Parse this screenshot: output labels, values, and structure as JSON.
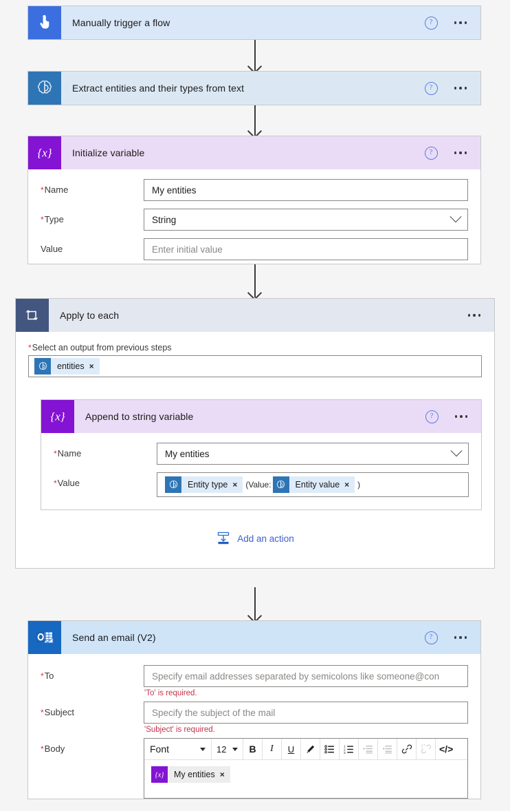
{
  "flow": {
    "steps": [
      {
        "id": "trigger",
        "title": "Manually trigger a flow",
        "icon": "hand-pointer-icon",
        "help_label": "?",
        "menu_label": "more-commands"
      },
      {
        "id": "extract-entities",
        "title": "Extract entities and their types from text",
        "icon": "ai-builder-brain-icon"
      },
      {
        "id": "initialize-variable",
        "title": "Initialize variable",
        "icon": "variable-braces-icon",
        "fields": {
          "name": {
            "label": "Name",
            "required": true,
            "value": "My entities"
          },
          "type": {
            "label": "Type",
            "required": true,
            "value": "String"
          },
          "value": {
            "label": "Value",
            "required": false,
            "value": "",
            "placeholder": "Enter initial value"
          }
        }
      },
      {
        "id": "apply-to-each",
        "title": "Apply to each",
        "icon": "loop-icon",
        "select_output": {
          "label": "Select an output from previous steps",
          "required": true,
          "token": {
            "text": "entities",
            "icon": "ai-builder-brain-icon",
            "remove": "×"
          }
        },
        "add_action": {
          "label": "Add an action",
          "icon": "add-action-icon"
        }
      },
      {
        "id": "append-to-string-variable",
        "title": "Append to string variable",
        "icon": "variable-braces-icon",
        "fields": {
          "name": {
            "label": "Name",
            "required": true,
            "value": "My entities"
          },
          "value": {
            "label": "Value",
            "required": true,
            "tokens": [
              {
                "text": "Entity type",
                "icon": "ai-builder-brain-icon",
                "remove": "×"
              },
              {
                "text": "Entity value",
                "icon": "ai-builder-brain-icon",
                "remove": "×"
              }
            ],
            "literal_open": "(Value:",
            "literal_close": ")"
          }
        }
      },
      {
        "id": "send-an-email",
        "title": "Send an email (V2)",
        "icon": "outlook-icon",
        "fields": {
          "to": {
            "label": "To",
            "required": true,
            "value": "",
            "placeholder": "Specify email addresses separated by semicolons like someone@con",
            "error": "'To' is required."
          },
          "subject": {
            "label": "Subject",
            "required": true,
            "value": "",
            "placeholder": "Specify the subject of the mail",
            "error": "'Subject' is required."
          },
          "body": {
            "label": "Body",
            "required": true,
            "token": {
              "text": "My entities",
              "icon": "variable-braces-icon",
              "remove": "×"
            }
          }
        }
      }
    ]
  },
  "rte_toolbar": {
    "font": {
      "label": "Font",
      "icon": "caret-down-icon"
    },
    "size": {
      "label": "12",
      "icon": "caret-down-icon"
    },
    "buttons": [
      {
        "name": "bold",
        "label": "B",
        "disabled": false
      },
      {
        "name": "italic",
        "label": "I",
        "disabled": false
      },
      {
        "name": "underline",
        "label": "U",
        "disabled": false
      },
      {
        "name": "text-color-pen",
        "label": "",
        "disabled": false
      },
      {
        "name": "bulleted-list",
        "label": "",
        "disabled": false
      },
      {
        "name": "numbered-list",
        "label": "",
        "disabled": false
      },
      {
        "name": "indent",
        "label": "",
        "disabled": true
      },
      {
        "name": "outdent",
        "label": "",
        "disabled": true
      },
      {
        "name": "insert-link",
        "label": "",
        "disabled": false
      },
      {
        "name": "remove-link",
        "label": "",
        "disabled": true
      },
      {
        "name": "code-view",
        "label": "</>",
        "disabled": false
      }
    ]
  },
  "colors": {
    "canvas": "#f5f5f5",
    "trigger_header": "#d9e7f8",
    "ai_header": "#dbe8f4",
    "variable_header": "#eadcf6",
    "loop_header": "#e3e7ef",
    "mail_header": "#cfe4f7",
    "accent_link": "#3b5fd0",
    "required_marker": "#d13438",
    "error_text": "#c4314b"
  }
}
